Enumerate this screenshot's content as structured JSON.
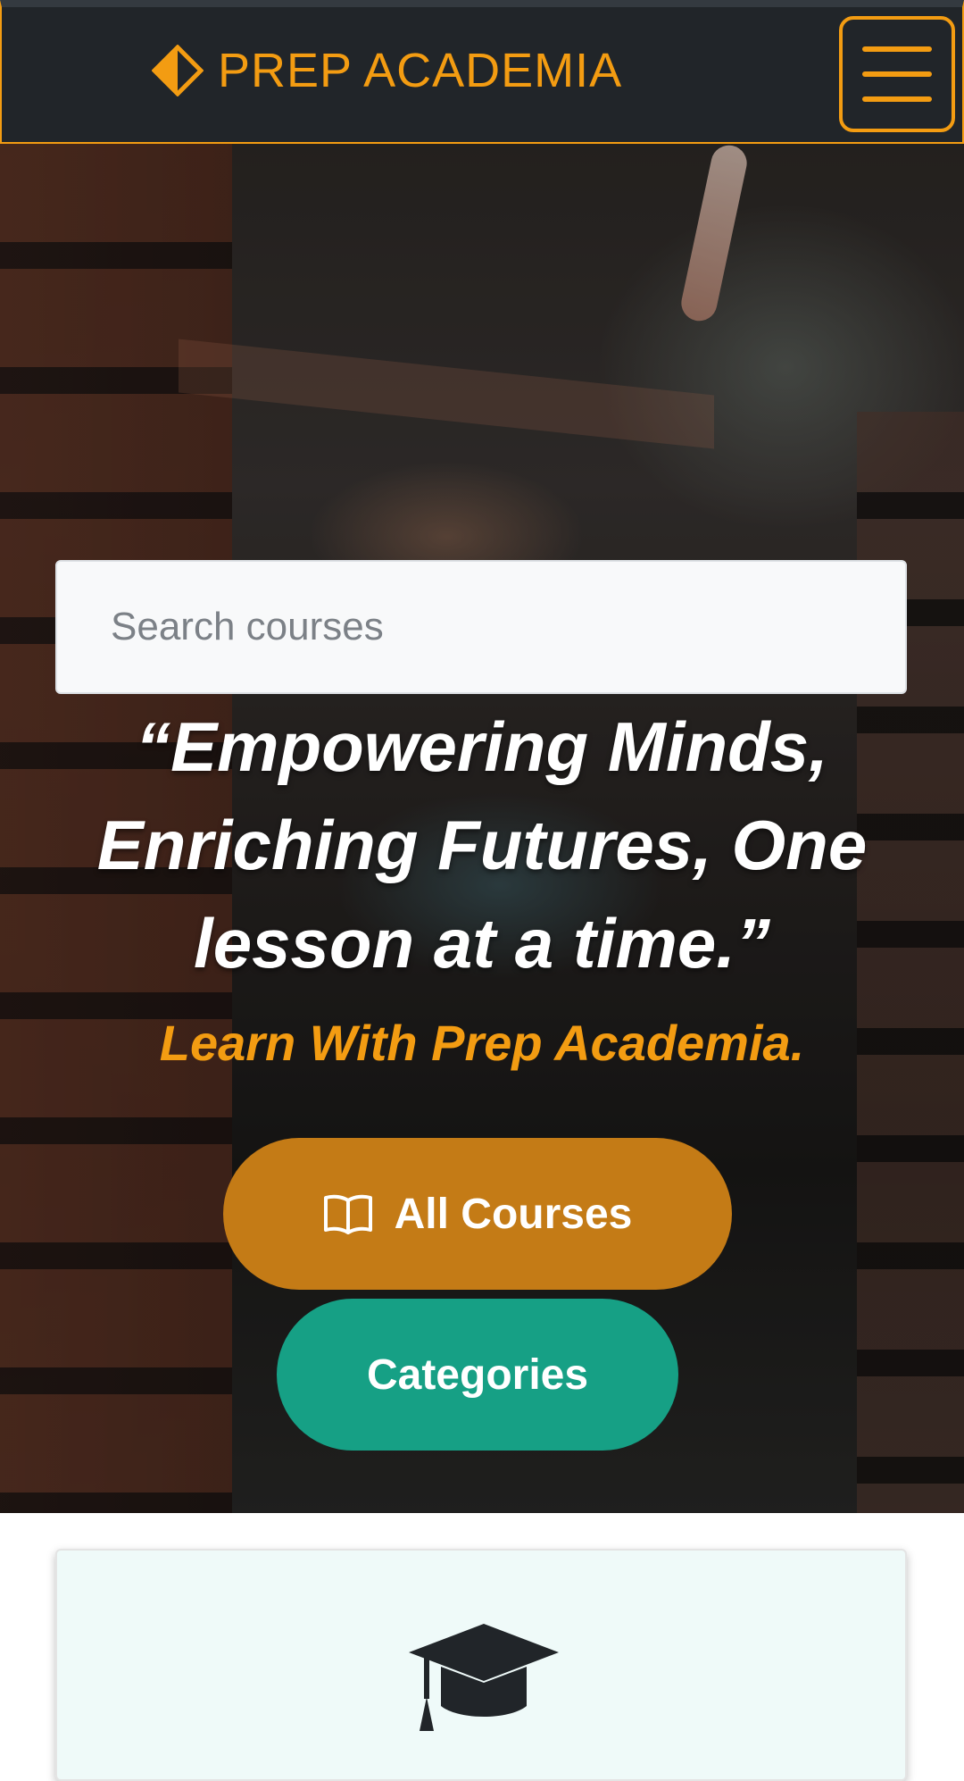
{
  "navbar": {
    "brand": "PREP ACADEMIA",
    "brand_icon": "diamond-logo-icon",
    "menu_icon": "hamburger-menu-icon"
  },
  "hero": {
    "search": {
      "placeholder": "Search courses",
      "value": ""
    },
    "quote": "“Empowering Minds, Enriching Futures, One lesson at a time.”",
    "tagline": "Learn With Prep Academia.",
    "buttons": {
      "courses_label": "All Courses",
      "courses_icon": "book-open-icon",
      "categories_label": "Categories"
    }
  },
  "feature_card": {
    "icon": "graduation-cap-icon"
  },
  "colors": {
    "accent": "#f39c12",
    "navbar_bg": "#212529",
    "courses_button": "#c47b16",
    "categories_button": "#16a085",
    "card_bg": "#effaf9"
  }
}
